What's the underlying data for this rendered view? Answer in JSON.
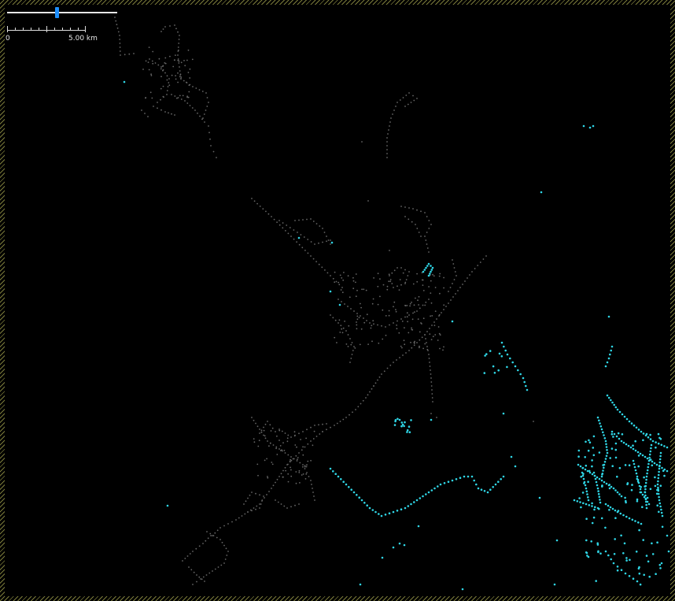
{
  "map": {
    "background": "#000000",
    "border_hatch_color": "#7a7a3a",
    "zoom_level": 0.45,
    "scale_bar": {
      "start_label": "0",
      "end_label": "5.00 km"
    },
    "layers": [
      {
        "name": "roads",
        "color": "#666666"
      },
      {
        "name": "points",
        "color": "#2fd6e6"
      }
    ]
  }
}
